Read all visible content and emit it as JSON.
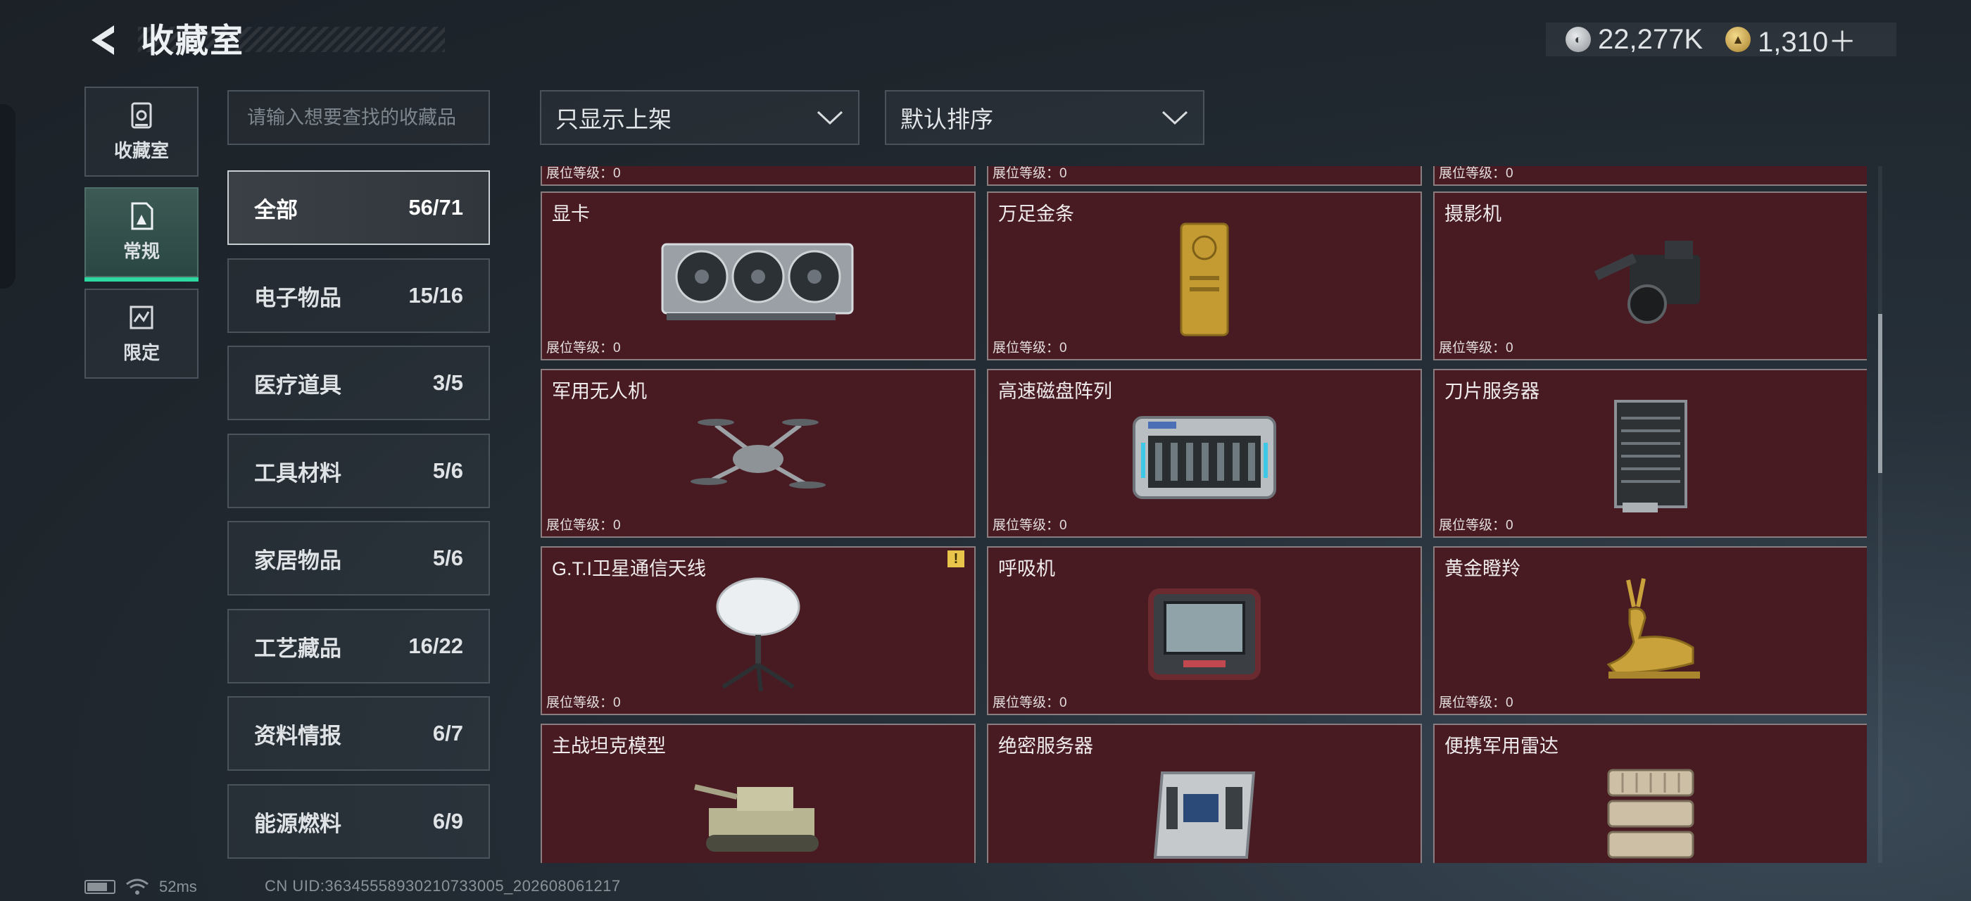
{
  "header": {
    "title": "收藏室",
    "currency": [
      {
        "icon": "silver-coin-icon",
        "value": "22,277K"
      },
      {
        "icon": "gold-coin-icon",
        "value": "1,310＋"
      }
    ]
  },
  "left_nav": [
    {
      "label": "收藏室",
      "icon": "vault-icon"
    },
    {
      "label": "常规",
      "icon": "regular-icon",
      "active": true
    },
    {
      "label": "限定",
      "icon": "limited-icon"
    }
  ],
  "search": {
    "placeholder": "请输入想要查找的收藏品"
  },
  "filters": {
    "display": "只显示上架",
    "sort": "默认排序"
  },
  "categories": [
    {
      "name": "全部",
      "count": "56/71",
      "active": true
    },
    {
      "name": "电子物品",
      "count": "15/16"
    },
    {
      "name": "医疗道具",
      "count": "3/5"
    },
    {
      "name": "工具材料",
      "count": "5/6"
    },
    {
      "name": "家居物品",
      "count": "5/6"
    },
    {
      "name": "工艺藏品",
      "count": "16/22"
    },
    {
      "name": "资料情报",
      "count": "6/7"
    },
    {
      "name": "能源燃料",
      "count": "6/9"
    }
  ],
  "items": [
    {
      "name": "",
      "level": "展位等级：0",
      "icon": ""
    },
    {
      "name": "",
      "level": "展位等级：0",
      "icon": ""
    },
    {
      "name": "",
      "level": "展位等级：0",
      "icon": ""
    },
    {
      "name": "显卡",
      "level": "展位等级：0",
      "icon": "graphics-card-icon"
    },
    {
      "name": "万足金条",
      "level": "展位等级：0",
      "icon": "gold-bar-icon"
    },
    {
      "name": "摄影机",
      "level": "展位等级：0",
      "icon": "video-camera-icon"
    },
    {
      "name": "军用无人机",
      "level": "展位等级：0",
      "icon": "drone-icon"
    },
    {
      "name": "高速磁盘阵列",
      "level": "展位等级：0",
      "icon": "disk-array-icon"
    },
    {
      "name": "刀片服务器",
      "level": "展位等级：0",
      "icon": "blade-server-icon"
    },
    {
      "name": "G.T.I卫星通信天线",
      "level": "展位等级：0",
      "icon": "satellite-antenna-icon",
      "warning": "!"
    },
    {
      "name": "呼吸机",
      "level": "展位等级：0",
      "icon": "ventilator-icon"
    },
    {
      "name": "黄金瞪羚",
      "level": "展位等级：0",
      "icon": "golden-gazelle-icon"
    },
    {
      "name": "主战坦克模型",
      "level": "",
      "icon": "tank-model-icon"
    },
    {
      "name": "绝密服务器",
      "level": "",
      "icon": "secret-server-icon"
    },
    {
      "name": "便携军用雷达",
      "level": "",
      "icon": "portable-radar-icon"
    }
  ],
  "status": {
    "ping": "52ms",
    "uid": "CN UID:36345558930210733005_202608061217"
  },
  "colors": {
    "card_bg": "#481b22",
    "accent": "#2bd9a1"
  }
}
